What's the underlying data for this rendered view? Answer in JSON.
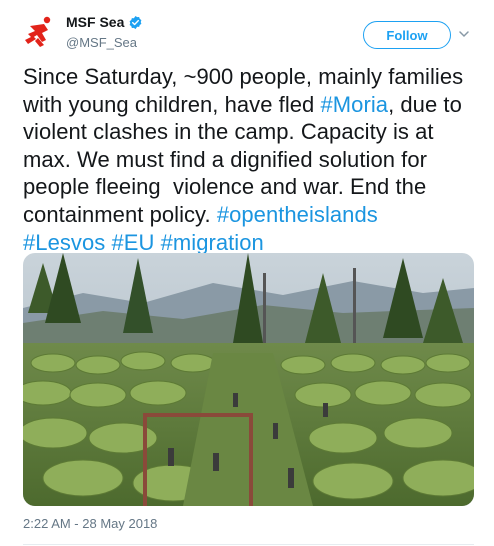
{
  "account": {
    "name": "MSF Sea",
    "handle": "@MSF_Sea",
    "logo_icon": "msf-running-man-logo",
    "verified_icon": "verified-badge-icon"
  },
  "actions": {
    "follow_label": "Follow",
    "menu_icon": "chevron-down-icon"
  },
  "tweet": {
    "segments": [
      {
        "text": "Since Saturday, ~900 people, mainly families with young children, have fled ",
        "type": "text"
      },
      {
        "text": "#Moria",
        "type": "hashtag"
      },
      {
        "text": ", due to violent clashes in the camp. Capacity is at max. We must find a dignified solution for people fleeing  violence and war. End the containment policy. ",
        "type": "text"
      },
      {
        "text": "#opentheislands",
        "type": "hashtag"
      },
      {
        "text": "\n",
        "type": "text"
      },
      {
        "text": "#Lesvos",
        "type": "hashtag"
      },
      {
        "text": " ",
        "type": "text"
      },
      {
        "text": "#EU",
        "type": "hashtag"
      },
      {
        "text": " ",
        "type": "text"
      },
      {
        "text": "#migration",
        "type": "hashtag"
      }
    ],
    "timestamp": "2:22 AM - 28 May 2018"
  },
  "colors": {
    "accent": "#1da1f2",
    "hashtag": "#1b95e0",
    "brand_red": "#e2231a",
    "muted": "#657786"
  }
}
